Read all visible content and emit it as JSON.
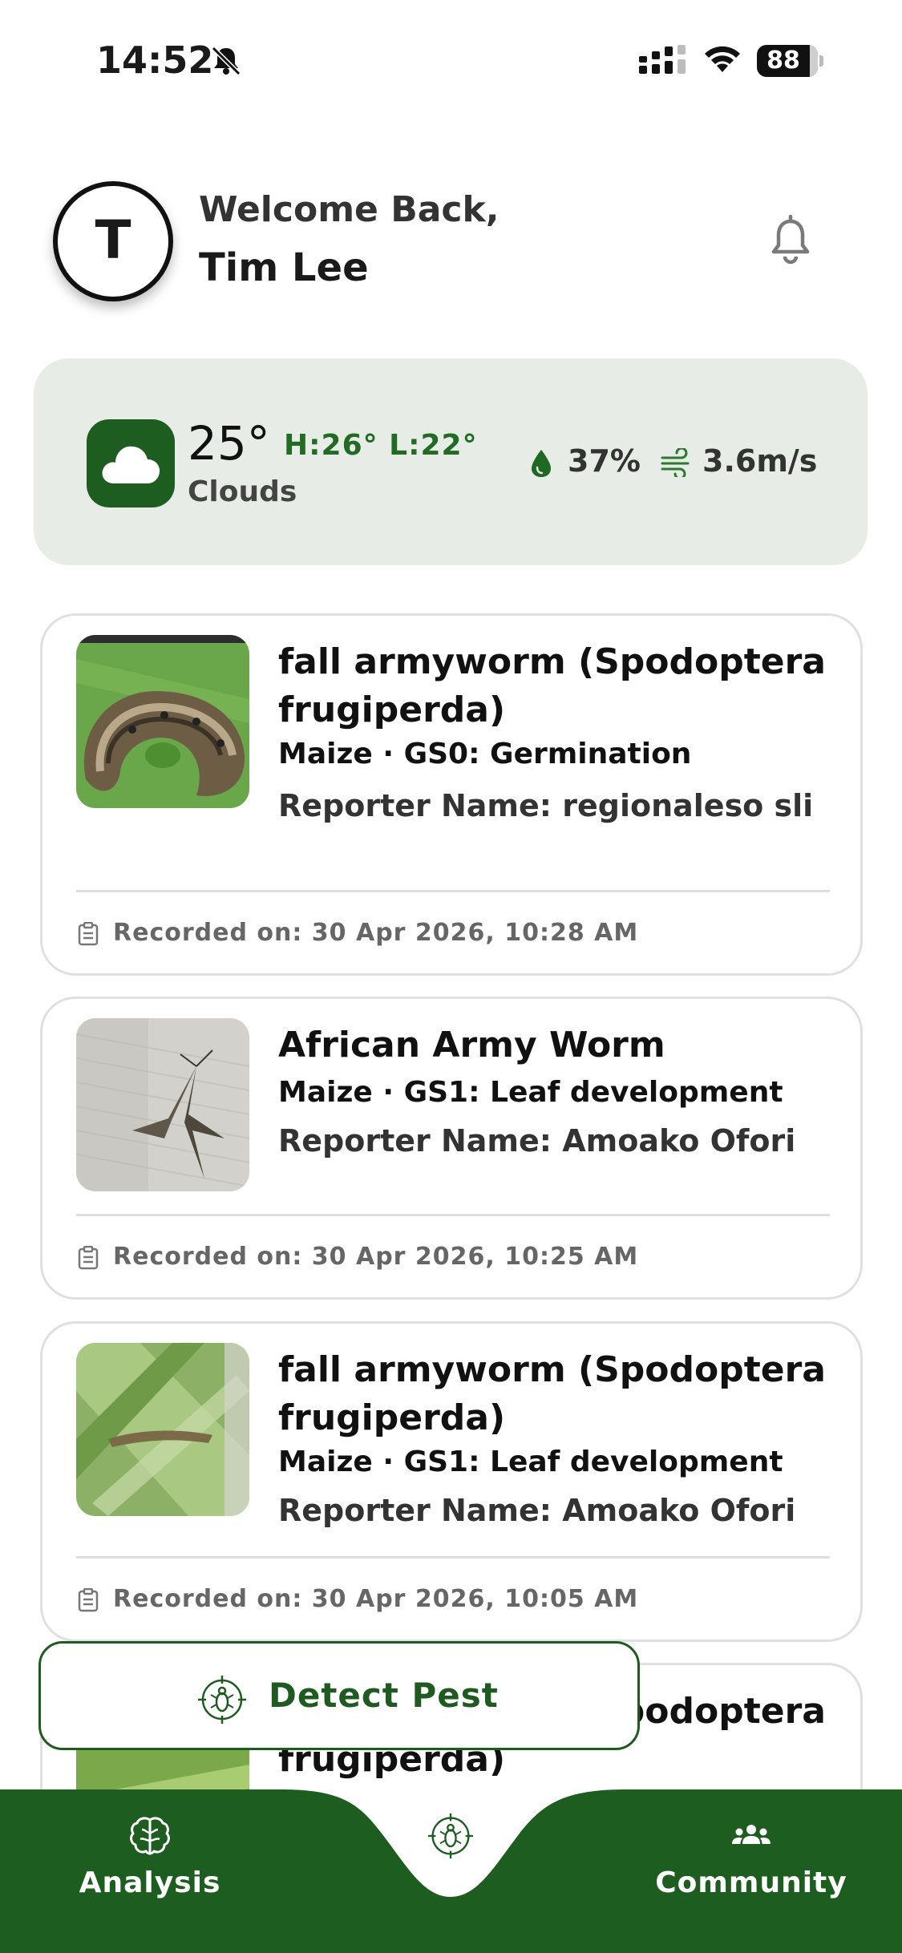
{
  "status_bar": {
    "time": "14:52",
    "battery": "88",
    "icons": [
      "bell-slash-icon",
      "signal-icon",
      "wifi-icon",
      "battery-icon"
    ]
  },
  "header": {
    "avatar_initial": "T",
    "welcome": "Welcome Back,",
    "name": "Tim Lee",
    "notification_icon": "bell-icon"
  },
  "weather": {
    "icon": "cloud-icon",
    "temperature": "25°",
    "hilo": "H:26° L:22°",
    "condition": "Clouds",
    "humidity": "37%",
    "wind": "3.6m/s"
  },
  "reports": [
    {
      "title": "fall armyworm (Spodoptera frugiperda)",
      "crop": "Maize · GS0: Germination",
      "reporter": "Reporter Name: regionaleso sli",
      "recorded": "Recorded on: 30 Apr 2026, 10:28 AM"
    },
    {
      "title": "African Army Worm",
      "crop": "Maize · GS1: Leaf development",
      "reporter": "Reporter Name: Amoako Ofori",
      "recorded": "Recorded on: 30 Apr 2026, 10:25 AM"
    },
    {
      "title": "fall armyworm (Spodoptera frugiperda)",
      "crop": "Maize · GS1: Leaf development",
      "reporter": "Reporter Name: Amoako Ofori",
      "recorded": "Recorded on: 30 Apr 2026, 10:05 AM"
    },
    {
      "title": "fall armyworm (Spodoptera frugiperda)"
    }
  ],
  "detect_button": {
    "label": "Detect Pest",
    "icon": "bug-target-icon"
  },
  "nav": {
    "analysis": "Analysis",
    "community": "Community",
    "icons": [
      "brain-icon",
      "bug-target-icon",
      "people-icon"
    ]
  },
  "colors": {
    "primary_green": "#1e5d20",
    "accent_green": "#226b24",
    "weather_card_bg": "#e7ece6"
  }
}
